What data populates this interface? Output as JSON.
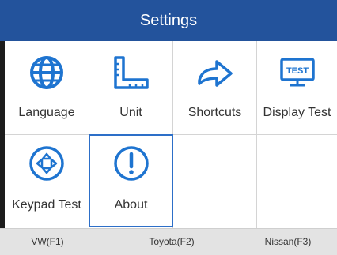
{
  "header": {
    "title": "Settings"
  },
  "items": [
    {
      "label": "Language",
      "icon": "globe-icon"
    },
    {
      "label": "Unit",
      "icon": "ruler-icon"
    },
    {
      "label": "Shortcuts",
      "icon": "arrow-right-icon"
    },
    {
      "label": "Display Test",
      "icon": "display-test-icon",
      "icon_text": "TEST"
    },
    {
      "label": "Keypad Test",
      "icon": "keypad-icon"
    },
    {
      "label": "About",
      "icon": "info-exclamation-icon"
    }
  ],
  "selected_item": "About",
  "footer": {
    "tabs": [
      {
        "label": "VW(F1)"
      },
      {
        "label": "Toyota(F2)"
      },
      {
        "label": "Nissan(F3)"
      }
    ]
  },
  "colors": {
    "header_bg": "#23539c",
    "icon_blue": "#1e74d0",
    "selection_border": "#2d6fc8",
    "footer_bg": "#e3e3e3"
  }
}
